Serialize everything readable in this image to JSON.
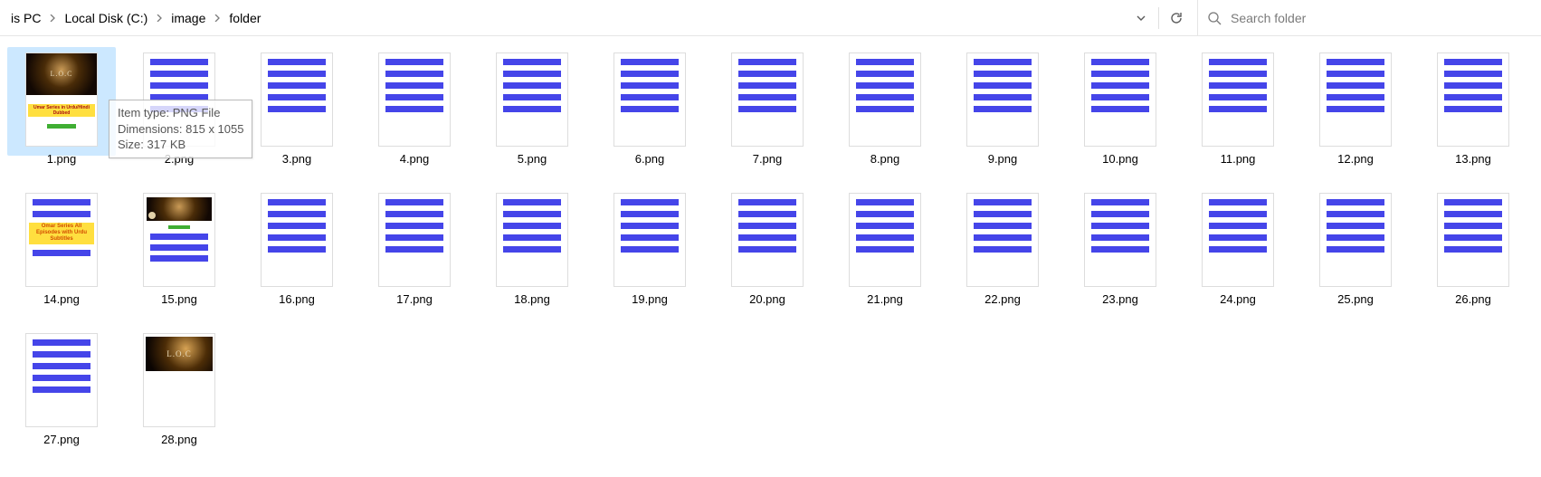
{
  "breadcrumbs": [
    "is PC",
    "Local Disk (C:)",
    "image",
    "folder"
  ],
  "search": {
    "placeholder": "Search folder"
  },
  "tooltip": {
    "line1": "Item type: PNG File",
    "line2": "Dimensions: 815 x 1055",
    "line3": "Size: 317 KB"
  },
  "thumb1": {
    "logo": "L.O.C",
    "caption": "Umar Series in Urdu/Hindi Dubbed"
  },
  "thumb14": {
    "highlight": "Omar Series All Episodes with Urdu Subtitles"
  },
  "thumb28": {
    "logo": "L.O.C"
  },
  "files": [
    {
      "name": "1.png",
      "variant": "t1",
      "selected": true
    },
    {
      "name": "2.png",
      "variant": "lines"
    },
    {
      "name": "3.png",
      "variant": "lines"
    },
    {
      "name": "4.png",
      "variant": "lines"
    },
    {
      "name": "5.png",
      "variant": "lines"
    },
    {
      "name": "6.png",
      "variant": "lines"
    },
    {
      "name": "7.png",
      "variant": "lines"
    },
    {
      "name": "8.png",
      "variant": "lines"
    },
    {
      "name": "9.png",
      "variant": "lines"
    },
    {
      "name": "10.png",
      "variant": "lines"
    },
    {
      "name": "11.png",
      "variant": "lines"
    },
    {
      "name": "12.png",
      "variant": "lines"
    },
    {
      "name": "13.png",
      "variant": "lines"
    },
    {
      "name": "14.png",
      "variant": "t14"
    },
    {
      "name": "15.png",
      "variant": "t15"
    },
    {
      "name": "16.png",
      "variant": "lines2"
    },
    {
      "name": "17.png",
      "variant": "lines2"
    },
    {
      "name": "18.png",
      "variant": "lines2"
    },
    {
      "name": "19.png",
      "variant": "lines2"
    },
    {
      "name": "20.png",
      "variant": "lines2"
    },
    {
      "name": "21.png",
      "variant": "lines2"
    },
    {
      "name": "22.png",
      "variant": "lines2"
    },
    {
      "name": "23.png",
      "variant": "lines2"
    },
    {
      "name": "24.png",
      "variant": "lines2"
    },
    {
      "name": "25.png",
      "variant": "lines2"
    },
    {
      "name": "26.png",
      "variant": "lines2"
    },
    {
      "name": "27.png",
      "variant": "lines2"
    },
    {
      "name": "28.png",
      "variant": "t28"
    }
  ]
}
